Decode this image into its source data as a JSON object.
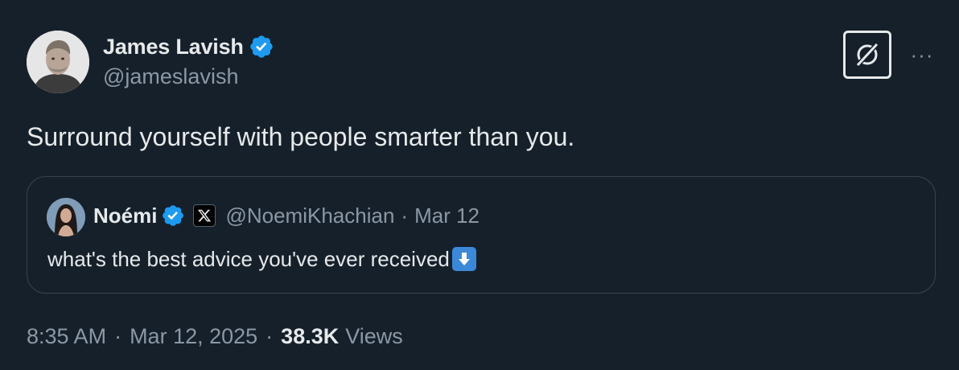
{
  "author": {
    "display_name": "James Lavish",
    "handle": "@jameslavish",
    "verified": true
  },
  "tweet": {
    "text": "Surround yourself with people smarter than you."
  },
  "quoted_tweet": {
    "display_name": "Noémi",
    "handle": "@NoemiKhachian",
    "separator": "·",
    "date": "Mar 12",
    "text": "what's the best advice you've ever received",
    "emoji": "down-arrow-emoji"
  },
  "meta": {
    "time": "8:35 AM",
    "separator": "·",
    "date": "Mar 12, 2025",
    "views_count": "38.3K",
    "views_label": "Views"
  },
  "actions": {
    "more": "···"
  },
  "colors": {
    "background": "#15202b",
    "primary_text": "#e7e9ea",
    "secondary_text": "#8b98a5",
    "verified_blue": "#1d9bf0",
    "border": "#38444d"
  },
  "icons": {
    "verified": "verified-badge-icon",
    "grok": "grok-icon",
    "more": "more-options-icon",
    "x_logo": "x-logo-icon"
  }
}
